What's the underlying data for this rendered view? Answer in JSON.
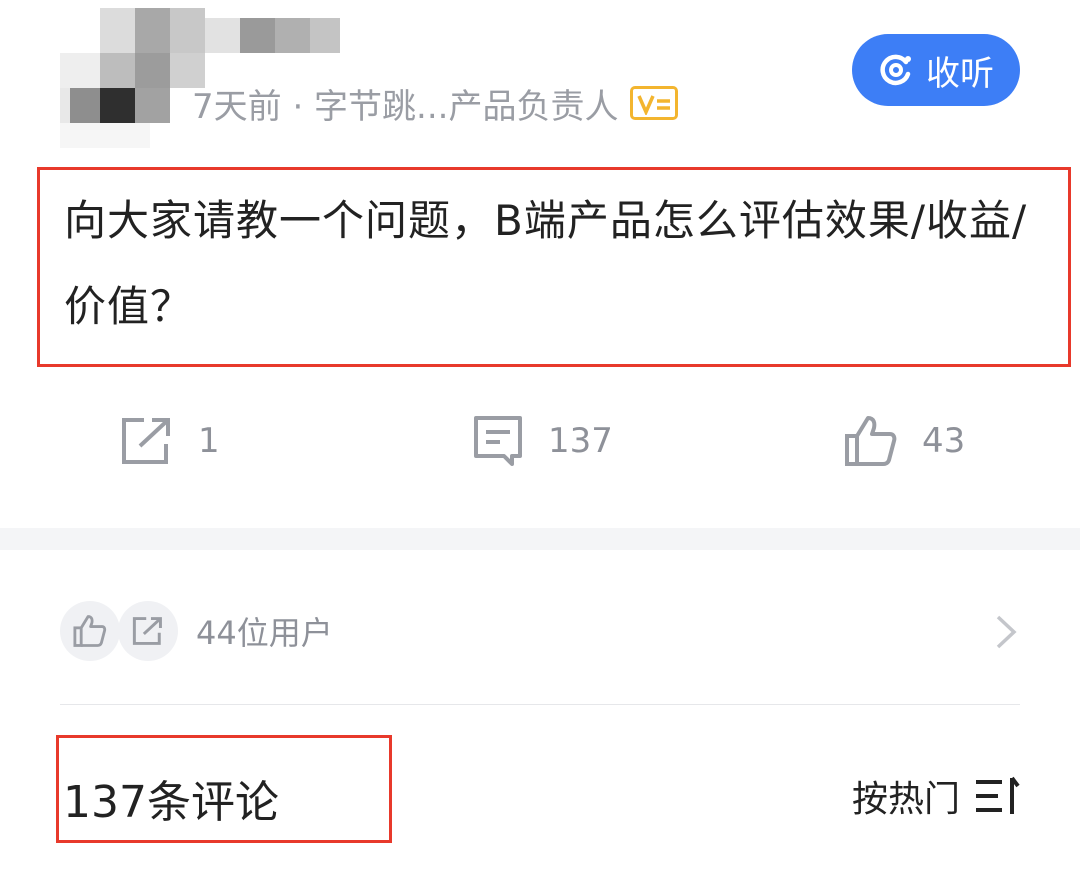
{
  "header": {
    "meta_text": "7天前 · 字节跳...产品负责人",
    "listen_label": "收听"
  },
  "post": {
    "question": "向大家请教一个问题，B端产品怎么评估效果/收益/价值？"
  },
  "actions": {
    "share_count": "1",
    "comment_count": "137",
    "like_count": "43"
  },
  "likers": {
    "label": "44位用户"
  },
  "comments": {
    "title": "137条评论",
    "sort_label": "按热门"
  },
  "colors": {
    "accent_blue": "#3d7ef6",
    "highlight_red": "#e8392b",
    "badge_yellow": "#f3b52f",
    "muted_text": "#9a9da4"
  },
  "icons": {
    "listen": "headphone-ring-icon",
    "verified": "v-badge-icon",
    "share": "share-icon",
    "comment": "comment-icon",
    "like": "thumbs-up-icon",
    "chevron": "chevron-right-icon",
    "sort": "sort-icon"
  }
}
